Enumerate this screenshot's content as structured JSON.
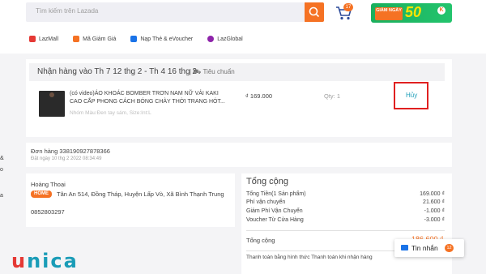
{
  "header": {
    "search_placeholder": "Tìm kiếm trên Lazada",
    "cart_count": "17"
  },
  "promo": {
    "giam_label": "GIẢM NGÀY",
    "big_value": "50",
    "k_label": "K"
  },
  "nav": {
    "items": [
      {
        "label": "LazMall",
        "color": "#e53935"
      },
      {
        "label": "Mã Giảm Giá",
        "color": "#f57224"
      },
      {
        "label": "Nạp Thẻ & eVoucher",
        "color": "#1a73e8"
      },
      {
        "label": "LazGlobal",
        "color": "#8e24aa"
      }
    ]
  },
  "shipment": {
    "delivery_text": "Nhận hàng vào Th 7 12 thg 2 - Th 4 16 thg 2",
    "standard": "Tiêu chuẩn"
  },
  "product": {
    "name": "(có video)ÁO KHOÁC BOMBER TRƠN NAM NỮ VẢI KAKI CAO CẤP PHONG CÁCH BÓNG CHÀY THỜI TRANG HÓT...",
    "variant": "Nhóm Màu:Đen tay sám, Size:Int:L",
    "price": "₫ 169.000",
    "qty": "Qty:  1",
    "cancel": "Hủy"
  },
  "order": {
    "number": "Đơn hàng 338190927878366",
    "date": "Đặt ngày 10 thg 2 2022 08:34:49"
  },
  "address": {
    "name": "Hoàng Thoại",
    "tag": "HOME",
    "line": "Tân An 514, Đồng Tháp, Huyện Lấp Vò, Xã Bình Thạnh Trung",
    "phone": "0852803297"
  },
  "summary": {
    "title": "Tổng cộng",
    "rows": [
      {
        "label": "Tổng Tiền(1 Sản phẩm)",
        "value": "169.000 ₫"
      },
      {
        "label": "Phí vận chuyển",
        "value": "21.600 ₫"
      },
      {
        "label": "Giảm Phí Vận Chuyển",
        "value": "-1.000 ₫"
      },
      {
        "label": "Voucher Từ Cửa Hàng",
        "value": "-3.000 ₫"
      }
    ],
    "total_label": "Tổng cộng",
    "total_value": "186.600 ₫",
    "payment": "Thanh toán bằng hình thức Thanh toán khi nhận hàng"
  },
  "chat": {
    "label": "Tin nhắn",
    "count": "12"
  },
  "side_marks": [
    "&",
    "o",
    "a"
  ],
  "brand": {
    "u": "u",
    "rest": "nica",
    "accent": "#1a9cb7",
    "orange": "#f57224"
  }
}
